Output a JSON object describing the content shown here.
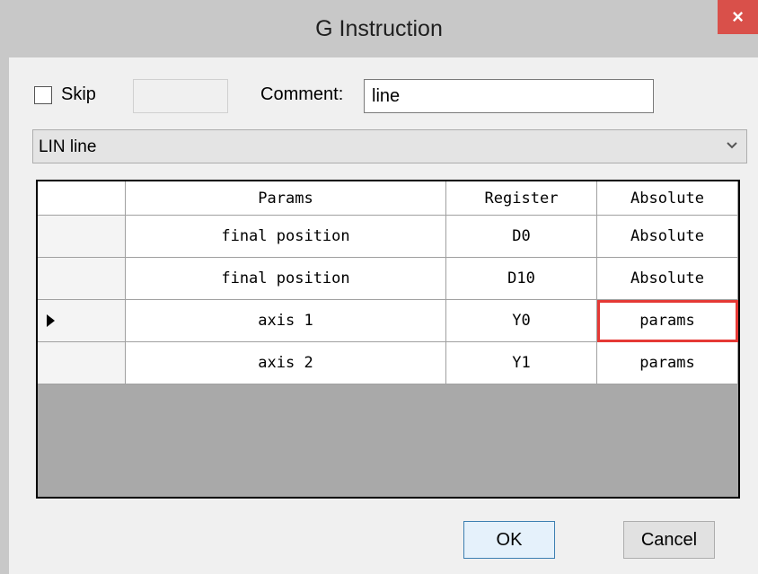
{
  "window": {
    "title": "G Instruction",
    "close_label": "×"
  },
  "form": {
    "skip_label": "Skip",
    "skip_checked": false,
    "skip_value": "",
    "comment_label": "Comment:",
    "comment_value": "line"
  },
  "instruction_select": {
    "selected": "LIN line"
  },
  "grid": {
    "columns": [
      "Params",
      "Register",
      "Absolute"
    ],
    "rows": [
      {
        "params": "final position",
        "register": "D0",
        "absolute": "Absolute",
        "current": false
      },
      {
        "params": "final position",
        "register": "D10",
        "absolute": "Absolute",
        "current": false
      },
      {
        "params": "axis 1",
        "register": "Y0",
        "absolute": "params",
        "current": true,
        "highlighted": "absolute"
      },
      {
        "params": "axis 2",
        "register": "Y1",
        "absolute": "params",
        "current": false
      }
    ]
  },
  "buttons": {
    "ok": "OK",
    "cancel": "Cancel"
  },
  "colors": {
    "highlight": "#e53935",
    "close": "#d9504a",
    "grid_empty": "#a9a9a9"
  },
  "icons": {
    "close": "close-icon",
    "dropdown": "chevron-down-icon",
    "row_selector": "row-pointer-icon"
  }
}
